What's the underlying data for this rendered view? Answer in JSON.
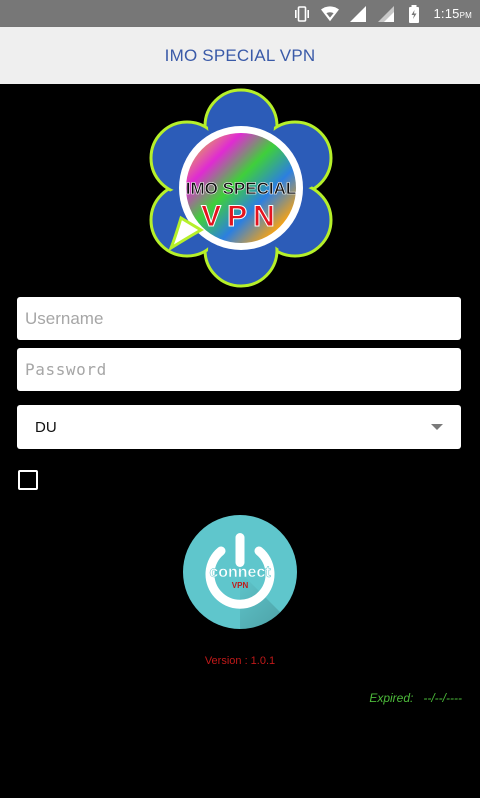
{
  "status_bar": {
    "time": "1:15",
    "ampm": "PM",
    "icons": [
      "vibrate-icon",
      "wifi-icon",
      "signal-icon",
      "signal-icon-2",
      "battery-icon"
    ]
  },
  "app_bar": {
    "title": "IMO SPECIAL VPN"
  },
  "logo": {
    "line1": "IMO SPECIAL",
    "line2": "VPN"
  },
  "form": {
    "username_placeholder": "Username",
    "password_placeholder": "Password",
    "server_selected": "DU",
    "checkbox_checked": false
  },
  "power_button": {
    "label": "connect",
    "sublabel": "VPN"
  },
  "footer": {
    "version": "Version : 1.0.1",
    "expired_label": "Expired:",
    "expired_value": "--/--/----"
  },
  "colors": {
    "status_bar": "#777777",
    "app_bar": "#efefef",
    "title": "#3a5aa8",
    "power_teal": "#5fc6cc",
    "version_red": "#c01919",
    "expired_green": "#4cba3a"
  }
}
